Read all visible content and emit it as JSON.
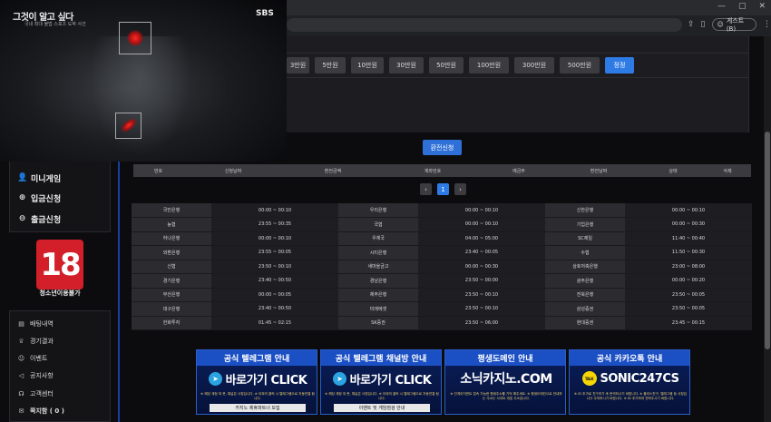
{
  "browser": {
    "profile_label": "게스트(B)",
    "window_controls": [
      "—",
      "▢",
      "✕"
    ]
  },
  "video": {
    "title": "그것이 알고 싶다",
    "subtitle": "국내 최대 불법 스포츠 도박 사건",
    "channel": "SBS"
  },
  "amount_buttons": [
    "3만원",
    "5만원",
    "10만원",
    "30만원",
    "50만원",
    "100만원",
    "300만원",
    "500만원",
    "정정"
  ],
  "apply_button": "환전신청",
  "sidebar": {
    "menu": [
      {
        "icon": "👤",
        "label": "미니게임"
      },
      {
        "icon": "⊕",
        "label": "입금신청"
      },
      {
        "icon": "⊖",
        "label": "출금신청"
      }
    ],
    "age_badge_number": "18",
    "age_badge_text": "청소년이용불가",
    "bottom": [
      {
        "icon": "▤",
        "label": "배팅내역"
      },
      {
        "icon": "♕",
        "label": "경기결과"
      },
      {
        "icon": "☺",
        "label": "이벤트"
      },
      {
        "icon": "◁",
        "label": "공지사항"
      },
      {
        "icon": "☊",
        "label": "고객센터"
      },
      {
        "icon": "✉",
        "label": "쪽지함 ( 0 )"
      }
    ]
  },
  "history_table": {
    "headers": [
      "번호",
      "신청날짜",
      "환전금액",
      "계좌번호",
      "예금주",
      "환전날짜",
      "상태",
      "삭제"
    ]
  },
  "pagination": {
    "prev": "‹",
    "current": "1",
    "next": "›"
  },
  "bank_schedule": [
    [
      "국민은행",
      "00:00 ~ 00:10",
      "우리은행",
      "00:00 ~ 00:10",
      "신한은행",
      "00:00 ~ 00:10"
    ],
    [
      "농협",
      "23:55 ~ 00:35",
      "국협",
      "00:00 ~ 00:10",
      "기업은행",
      "00:00 ~ 00:30"
    ],
    [
      "하나은행",
      "00:00 ~ 00:10",
      "우체국",
      "04:00 ~ 05:00",
      "SC제일",
      "11:40 ~ 00:40"
    ],
    [
      "외환은행",
      "23:55 ~ 00:05",
      "시티은행",
      "23:40 ~ 00:05",
      "수협",
      "11:50 ~ 00:30"
    ],
    [
      "신협",
      "23:50 ~ 00:10",
      "새마을금고",
      "00:00 ~ 00:30",
      "상호저축은행",
      "23:00 ~ 08:00"
    ],
    [
      "경기은행",
      "23:40 ~ 00:50",
      "경남은행",
      "23:50 ~ 00:00",
      "광주은행",
      "00:00 ~ 00:20"
    ],
    [
      "부산은행",
      "00:00 ~ 00:05",
      "제주은행",
      "23:50 ~ 00:10",
      "전북은행",
      "23:50 ~ 00:05"
    ],
    [
      "대구은행",
      "23:40 ~ 00:50",
      "미래에셋",
      "23:50 ~ 00:10",
      "삼성증권",
      "23:50 ~ 00:05"
    ],
    [
      "한화투자",
      "01:45 ~ 02:15",
      "SK증권",
      "23:50 ~ 06:00",
      "현대증권",
      "23:45 ~ 00:15"
    ]
  ],
  "banners": [
    {
      "head": "공식 텔레그램 안내",
      "big": "바로가기 CLICK",
      "icon": "telegram",
      "note": "※ 해당 계정 외 봇, 채널은 사칭입니다. ※ 이외의 클릭 시 텔레그램으로 자동연결 됩니다.",
      "foot": "카지노 제휴파트너 모집"
    },
    {
      "head": "공식 텔레그램 채널방 안내",
      "big": "바로가기 CLICK",
      "icon": "telegram",
      "note": "※ 해당 계정 외 봇, 채널은 사칭입니다. ※ 이외의 클릭 시 텔레그램으로 자동연결 됩니다.",
      "foot": "이벤트 및 게임점검 안내"
    },
    {
      "head": "평생도메인 안내",
      "big": "소닉카지노.COM",
      "icon": "",
      "note": "※ 인게이지먼트 접속 가능한 평생주소를 기억 해주세요. ※ 평생도메인으로 안내하는 주소는 사이트 대표 주소입니다.",
      "foot": ""
    },
    {
      "head": "공식 카카오톡 안내",
      "big": "SONIC247CS",
      "icon": "kakao",
      "note": "※ ID 추가로 친구추가 후 문의하시기 바랍니다. ※ 플러스친구, 텔레그램 등 사칭입니다 주의하시기 바랍니다. ※ ID 추가하여 연락주시기 바랍니다.",
      "foot": ""
    }
  ],
  "colors": {
    "accent": "#2e7be6",
    "badge": "#d21f2a",
    "banner_head": "#1b4fc4"
  }
}
